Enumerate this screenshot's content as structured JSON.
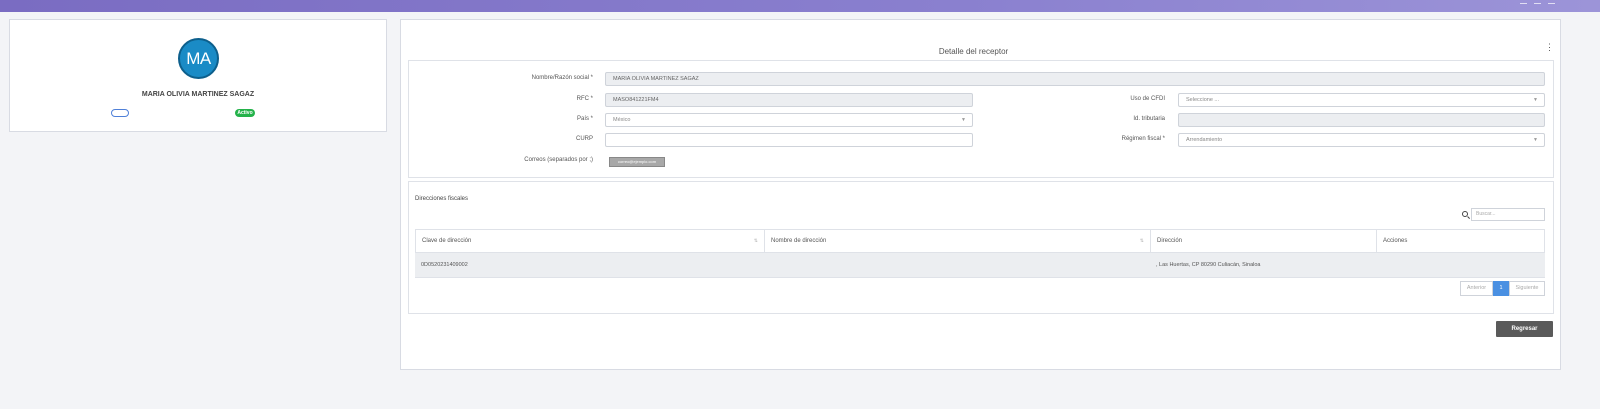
{
  "profile": {
    "initials": "MA",
    "name": "MARIA OLIVIA MARTINEZ SAGAZ",
    "status": "Activo"
  },
  "detail": {
    "title": "Detalle del receptor",
    "menu_icon": "⋮",
    "form": {
      "nombre_label": "Nombre/Razón social *",
      "nombre_value": "MARIA OLIVIA MARTINEZ SAGAZ",
      "rfc_label": "RFC *",
      "rfc_value": "MASO841221FM4",
      "uso_cfdi_label": "Uso de CFDI",
      "uso_cfdi_placeholder": "Seleccione ...",
      "pais_label": "País *",
      "pais_value": "México",
      "id_tributaria_label": "Id. tributaria",
      "id_tributaria_value": "",
      "curp_label": "CURP",
      "curp_value": "",
      "regimen_label": "Régimen fiscal *",
      "regimen_value": "Arrendamiento",
      "correos_label": "Correos (separados por ;)",
      "correos_chip": "correo@ejemplo.com"
    },
    "addresses": {
      "title": "Direcciones fiscales",
      "search_placeholder": "Buscar...",
      "columns": [
        "Clave de dirección",
        "Nombre de dirección",
        "Dirección",
        "Acciones"
      ],
      "rows": [
        {
          "clave": "0D0520231409002",
          "nombre": "",
          "direccion": ", Las Huertas, CP 80290 Culiacán, Sinaloa",
          "acciones": ""
        }
      ],
      "pagination": {
        "prev": "Anterior",
        "page": "1",
        "next": "Siguiente"
      }
    },
    "back_button": "Regresar"
  }
}
